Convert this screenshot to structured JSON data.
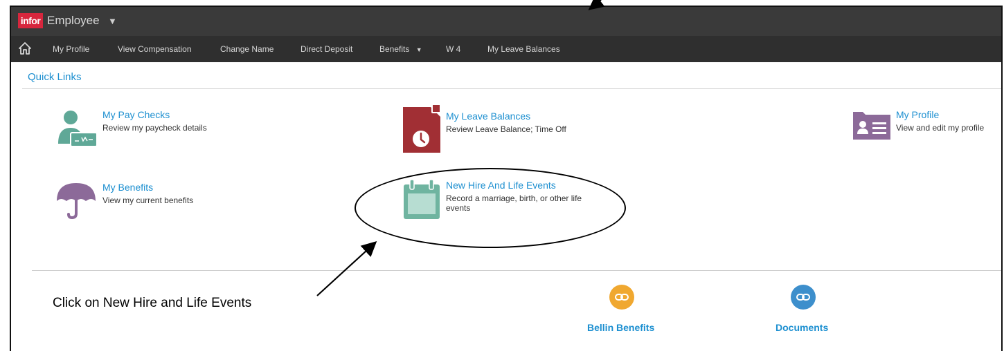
{
  "app": {
    "logo": "infor",
    "title": "Employee"
  },
  "nav": {
    "items": [
      {
        "label": "My Profile"
      },
      {
        "label": "View Compensation"
      },
      {
        "label": "Change Name"
      },
      {
        "label": "Direct Deposit"
      },
      {
        "label": "Benefits"
      },
      {
        "label": "W 4"
      },
      {
        "label": "My Leave Balances"
      }
    ]
  },
  "quick_links": {
    "title": "Quick Links",
    "items": [
      {
        "title": "My Pay Checks",
        "desc": "Review my paycheck details",
        "icon": "paycheck-icon",
        "color": "#5fa897"
      },
      {
        "title": "My Leave Balances",
        "desc": "Review Leave Balance; Time Off",
        "icon": "leave-clock-icon",
        "color": "#a12f34"
      },
      {
        "title": "My Profile",
        "desc": "View and edit my profile",
        "icon": "profile-card-icon",
        "color": "#8c6a99"
      },
      {
        "title": "My Benefits",
        "desc": "View my current benefits",
        "icon": "umbrella-icon",
        "color": "#8c6a99"
      },
      {
        "title": "New Hire And Life Events",
        "desc": "Record a marriage, birth, or other life events",
        "icon": "calendar-icon",
        "color": "#6fb4a0"
      }
    ]
  },
  "annotation": {
    "text": "Click on New Hire and Life Events"
  },
  "favorites": [
    {
      "label": "Bellin Benefits",
      "icon": "link-icon",
      "color": "#f0a830"
    },
    {
      "label": "Documents",
      "icon": "link-icon",
      "color": "#3d8fcc"
    }
  ]
}
